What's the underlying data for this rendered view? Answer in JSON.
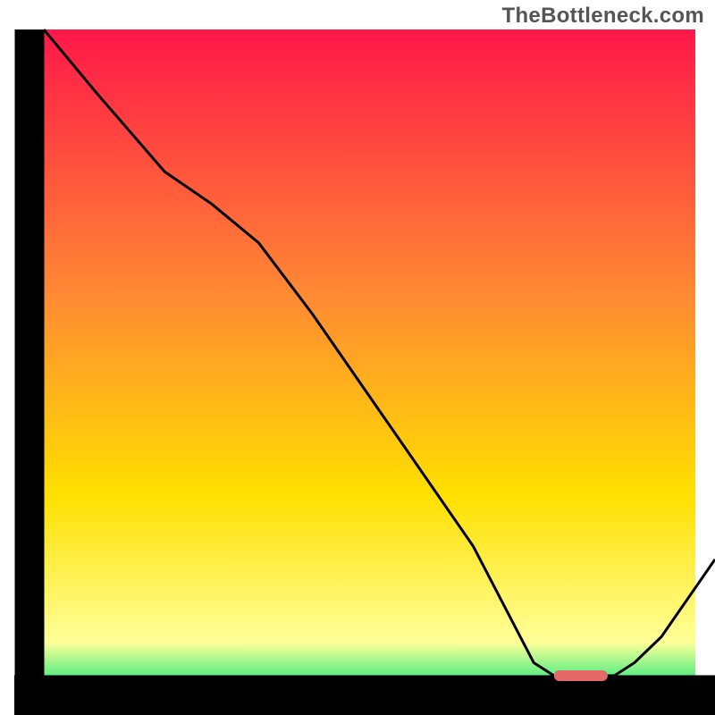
{
  "watermark": "TheBottleneck.com",
  "colors": {
    "top": "#ff1749",
    "orange": "#ff8a33",
    "yellow": "#ffe000",
    "pale_yellow": "#ffff99",
    "green": "#00e676",
    "curve": "#000000",
    "axes": "#000000",
    "marker": "#e46a6a"
  },
  "chart_data": {
    "type": "line",
    "title": "",
    "xlabel": "",
    "ylabel": "",
    "xlim": [
      0,
      100
    ],
    "ylim": [
      0,
      100
    ],
    "x": [
      0,
      8,
      18,
      25,
      32,
      40,
      48,
      56,
      64,
      70,
      73,
      76,
      79,
      82,
      85,
      88,
      92,
      96,
      100
    ],
    "values": [
      100,
      90,
      78,
      73,
      67,
      56,
      44,
      32,
      20,
      8,
      2,
      0,
      0,
      0,
      0,
      2,
      6,
      12,
      18
    ],
    "marker": {
      "x_start": 76,
      "x_end": 84,
      "y": 0
    }
  }
}
